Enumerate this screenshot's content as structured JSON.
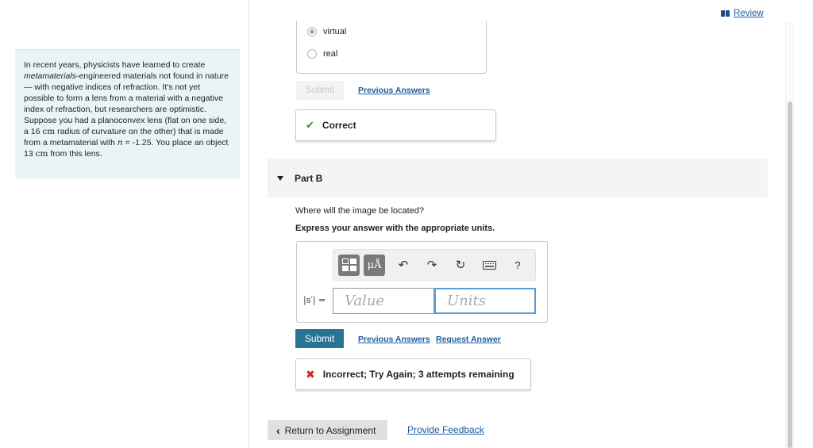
{
  "header": {
    "review_label": "Review"
  },
  "problem": {
    "text_before": "In recent years, physicists have learned to create ",
    "em_term": "metamaterials",
    "text_middle": "-engineered materials not found in nature— with negative indices of refraction. It's not yet possible to form a lens from a material with a negative index of refraction, but researchers are optimistic. Suppose you had a planoconvex lens (flat on one side, a 16 ",
    "unit_cm_1": "cm",
    "text_after_radius": " radius of curvature on the other) that is made from a metamaterial with ",
    "n_symbol": "n",
    "n_value": " = -1.25. You place an object 13 ",
    "unit_cm_2": "cm",
    "text_end": " from this lens."
  },
  "part_a": {
    "options": [
      {
        "label": "virtual",
        "selected": true
      },
      {
        "label": "real",
        "selected": false
      }
    ],
    "submit_label": "Submit",
    "previous_answers_label": "Previous Answers",
    "result_label": "Correct"
  },
  "part_b": {
    "title": "Part B",
    "question": "Where will the image be located?",
    "instruction": "Express your answer with the appropriate units.",
    "toolbar": {
      "templates_icon": "templates-icon",
      "units_label": "μÅ",
      "help_label": "?"
    },
    "equation_label": "|s′| =",
    "value_placeholder": "Value",
    "units_placeholder": "Units",
    "submit_label": "Submit",
    "previous_answers_label": "Previous Answers",
    "request_answer_label": "Request Answer",
    "result_label": "Incorrect; Try Again; 3 attempts remaining"
  },
  "footer": {
    "return_label": "Return to Assignment",
    "feedback_label": "Provide Feedback"
  },
  "colors": {
    "link": "#1d5b9e",
    "submit_bg": "#2a7395",
    "correct": "#3f8f2a",
    "incorrect": "#d0281f",
    "problem_bg": "#e8f4f6"
  }
}
